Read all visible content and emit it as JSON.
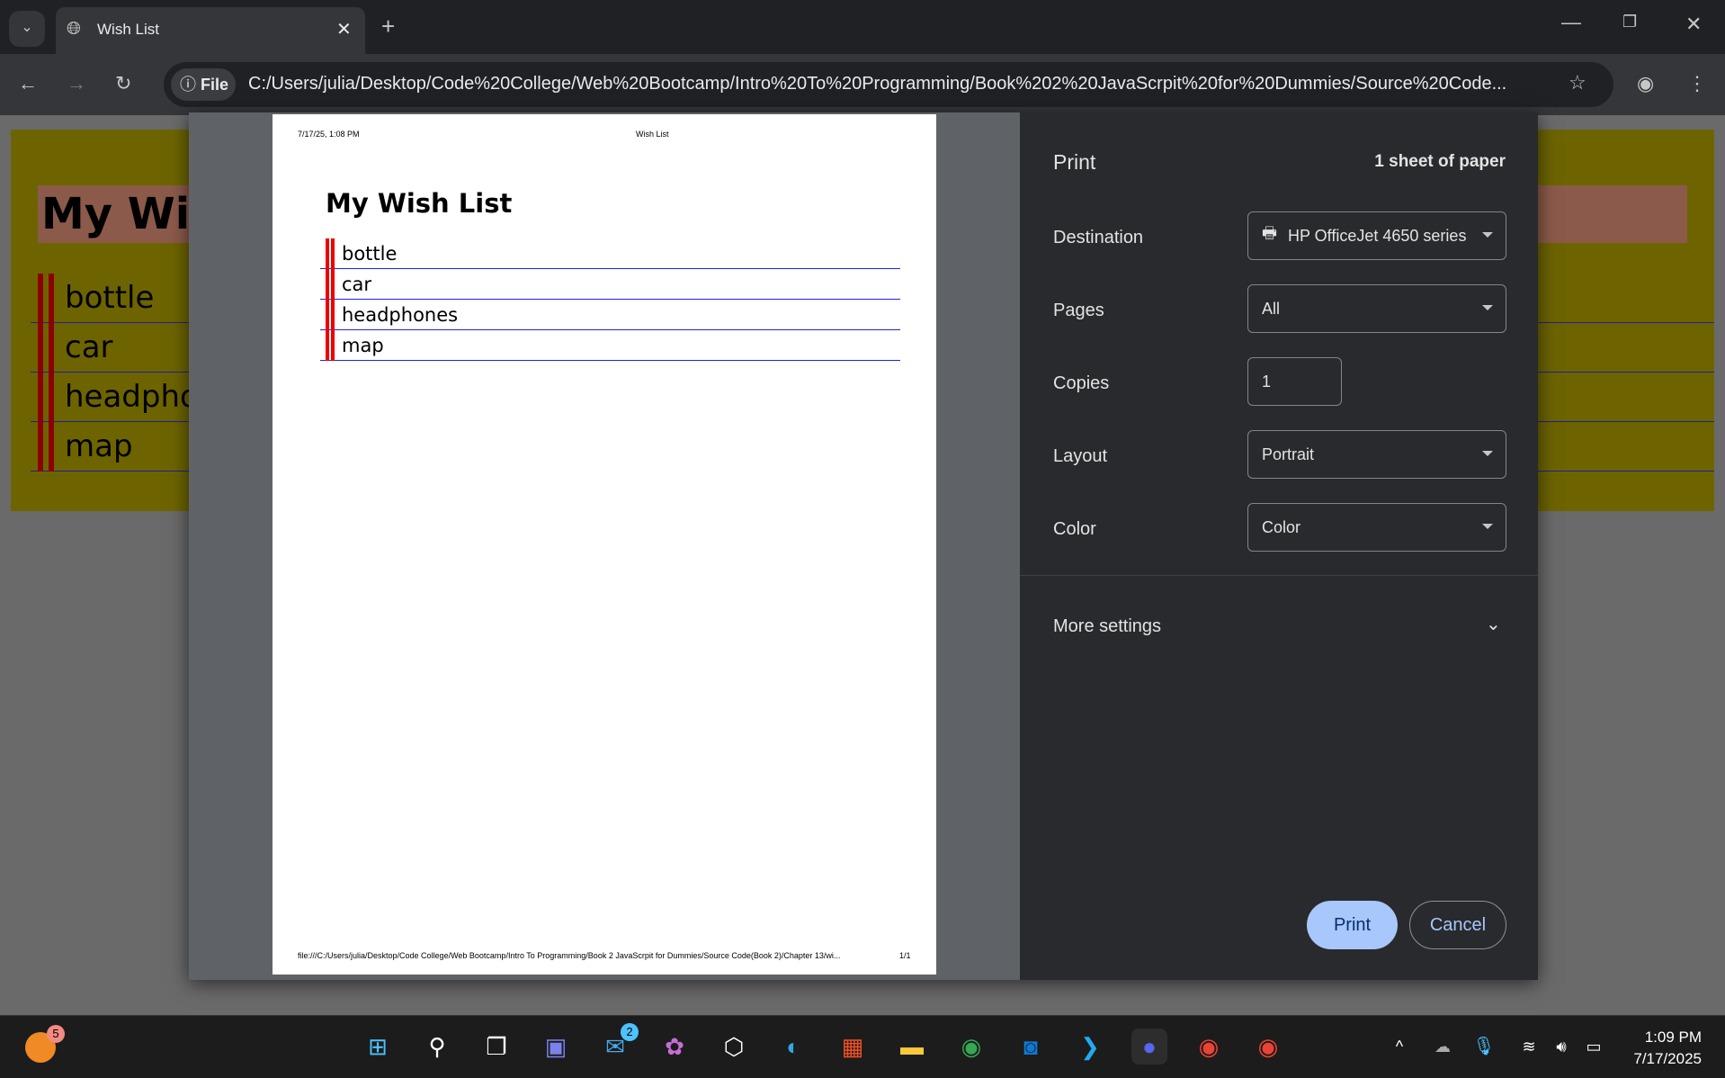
{
  "browser": {
    "tab_title": "Wish List",
    "address_chip": "File",
    "url": "C:/Users/julia/Desktop/Code%20College/Web%20Bootcamp/Intro%20To%20Programming/Book%202%20JavaScrpit%20for%20Dummies/Source%20Code..."
  },
  "page": {
    "title": "My Wish List",
    "items": [
      "bottle",
      "car",
      "headphones",
      "map"
    ]
  },
  "preview": {
    "header_date": "7/17/25, 1:08 PM",
    "header_title": "Wish List",
    "footer_url": "file:///C:/Users/julia/Desktop/Code College/Web Bootcamp/Intro To Programming/Book 2 JavaScrpit for Dummies/Source Code(Book 2)/Chapter 13/wi...",
    "footer_page": "1/1"
  },
  "print": {
    "title": "Print",
    "sheets": "1 sheet of paper",
    "destination_label": "Destination",
    "destination": "HP OfficeJet 4650 series",
    "pages_label": "Pages",
    "pages": "All",
    "copies_label": "Copies",
    "copies": "1",
    "layout_label": "Layout",
    "layout": "Portrait",
    "color_label": "Color",
    "color": "Color",
    "more_settings": "More settings",
    "print_button": "Print",
    "cancel_button": "Cancel"
  },
  "taskbar": {
    "time": "1:09 PM",
    "date": "7/17/2025",
    "mail_badge": "2",
    "notif_badge": "5"
  }
}
